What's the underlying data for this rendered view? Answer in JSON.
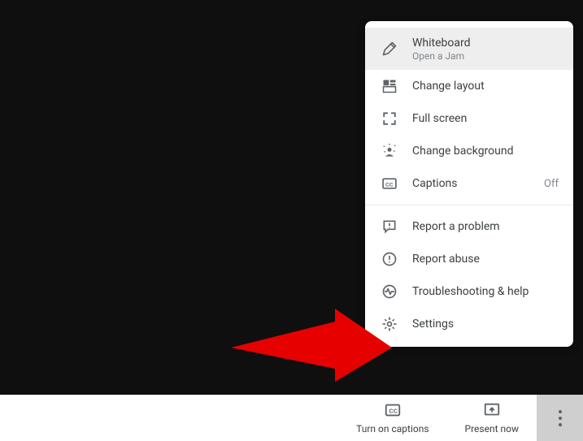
{
  "menu": {
    "whiteboard": {
      "label": "Whiteboard",
      "sub": "Open a Jam"
    },
    "change_layout": {
      "label": "Change layout"
    },
    "full_screen": {
      "label": "Full screen"
    },
    "change_background": {
      "label": "Change background"
    },
    "captions": {
      "label": "Captions",
      "trail": "Off"
    },
    "report_problem": {
      "label": "Report a problem"
    },
    "report_abuse": {
      "label": "Report abuse"
    },
    "troubleshooting": {
      "label": "Troubleshooting & help"
    },
    "settings": {
      "label": "Settings"
    }
  },
  "bottom": {
    "captions": {
      "label": "Turn on captions"
    },
    "present": {
      "label": "Present now"
    }
  }
}
